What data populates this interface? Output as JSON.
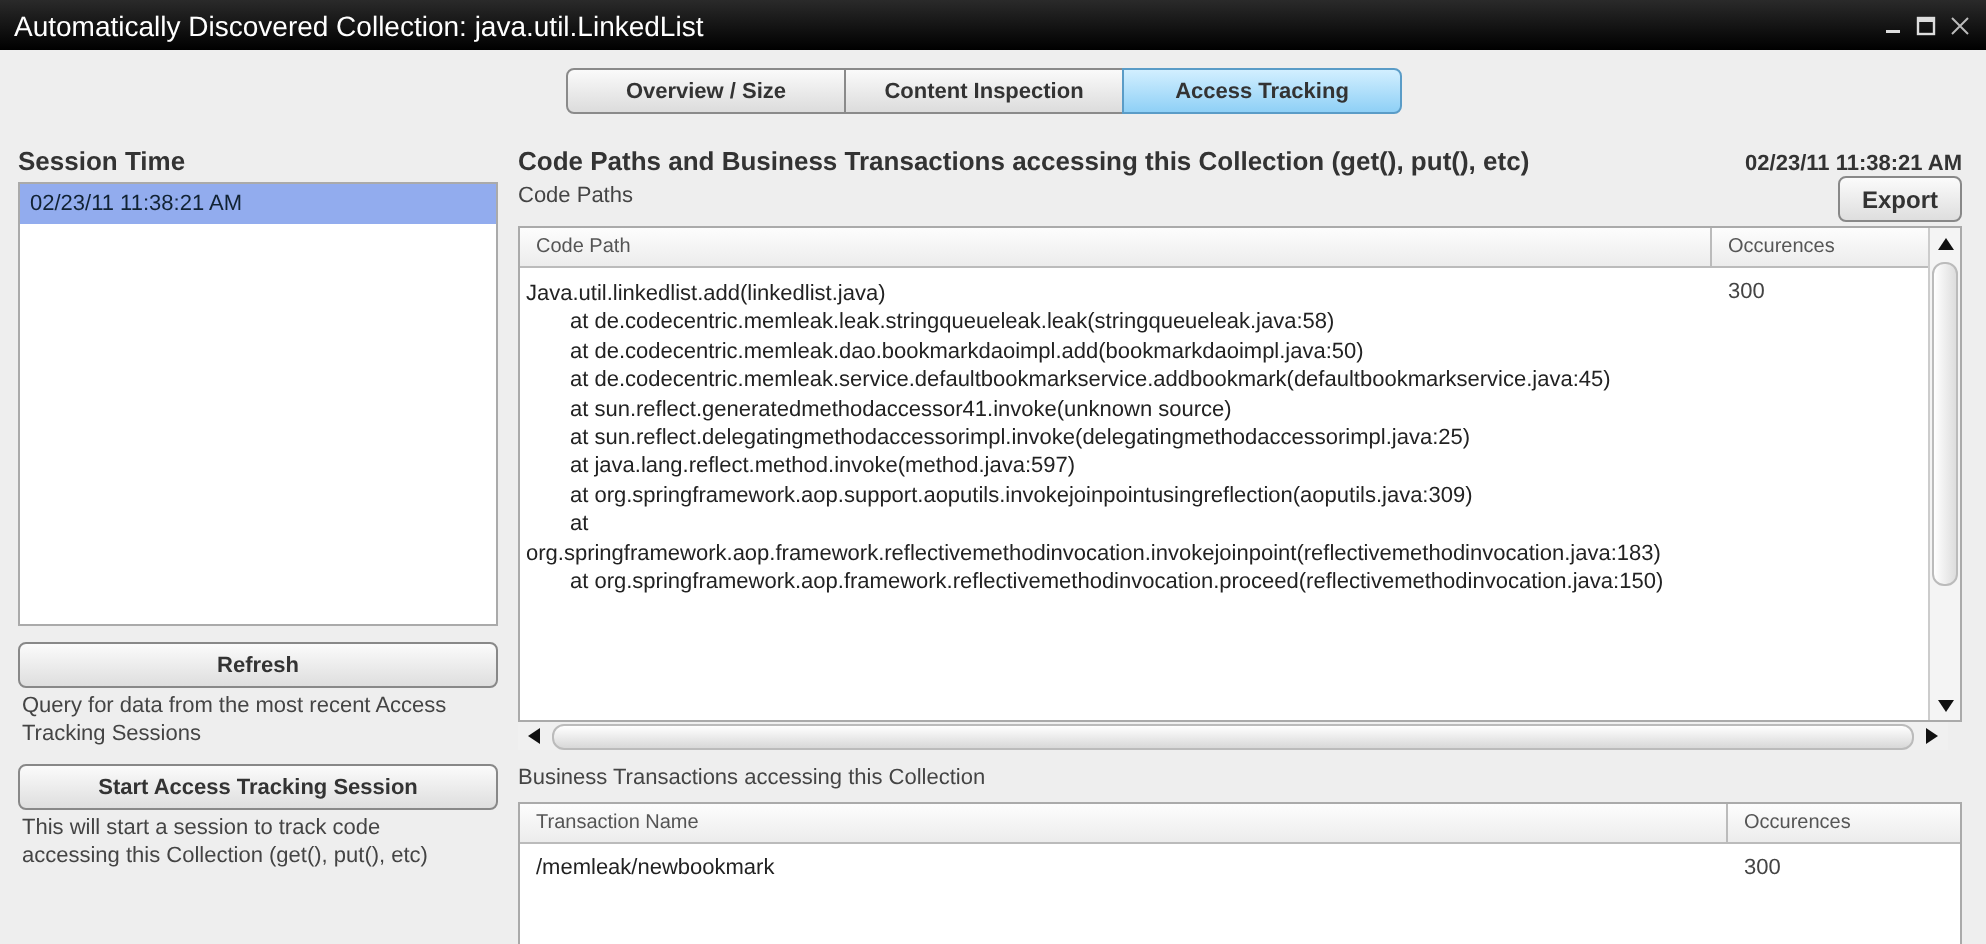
{
  "window": {
    "title": "Automatically Discovered Collection: java.util.LinkedList"
  },
  "tabs": [
    {
      "label": "Overview / Size",
      "selected": false
    },
    {
      "label": "Content Inspection",
      "selected": false
    },
    {
      "label": "Access Tracking",
      "selected": true
    }
  ],
  "sidebar": {
    "title": "Session Time",
    "sessions": [
      {
        "label": "02/23/11 11:38:21 AM",
        "selected": true
      }
    ],
    "actions": [
      {
        "button": "Refresh",
        "description": "Query for data from the most recent Access Tracking Sessions"
      },
      {
        "button": "Start Access Tracking Session",
        "description": "This will start a session to track code accessing this Collection (get(), put(), etc)"
      }
    ]
  },
  "main": {
    "title": "Code Paths and Business Transactions accessing this Collection (get(), put(), etc)",
    "timestamp": "02/23/11 11:38:21 AM",
    "code_paths": {
      "label": "Code Paths",
      "export_button": "Export",
      "columns": [
        "Code Path",
        "Occurences"
      ],
      "rows": [
        {
          "lines": [
            {
              "text": "Java.util.linkedlist.add(linkedlist.java)",
              "indented": false
            },
            {
              "text": "at de.codecentric.memleak.leak.stringqueueleak.leak(stringqueueleak.java:58)",
              "indented": true
            },
            {
              "text": "at de.codecentric.memleak.dao.bookmarkdaoimpl.add(bookmarkdaoimpl.java:50)",
              "indented": true
            },
            {
              "text": "at de.codecentric.memleak.service.defaultbookmarkservice.addbookmark(defaultbookmarkservice.java:45)",
              "indented": true
            },
            {
              "text": "at sun.reflect.generatedmethodaccessor41.invoke(unknown source)",
              "indented": true
            },
            {
              "text": "at sun.reflect.delegatingmethodaccessorimpl.invoke(delegatingmethodaccessorimpl.java:25)",
              "indented": true
            },
            {
              "text": "at java.lang.reflect.method.invoke(method.java:597)",
              "indented": true
            },
            {
              "text": "at org.springframework.aop.support.aoputils.invokejoinpointusingreflection(aoputils.java:309)",
              "indented": true
            },
            {
              "text": "at",
              "indented": true
            },
            {
              "text": "org.springframework.aop.framework.reflectivemethodinvocation.invokejoinpoint(reflectivemethodinvocation.java:183)",
              "indented": false
            },
            {
              "text": "at org.springframework.aop.framework.reflectivemethodinvocation.proceed(reflectivemethodinvocation.java:150)",
              "indented": true
            }
          ],
          "occurences": "300"
        }
      ]
    },
    "transactions": {
      "label": "Business Transactions accessing this Collection",
      "columns": [
        "Transaction Name",
        "Occurences"
      ],
      "rows": [
        {
          "name": "/memleak/newbookmark",
          "occurences": "300"
        }
      ]
    }
  }
}
